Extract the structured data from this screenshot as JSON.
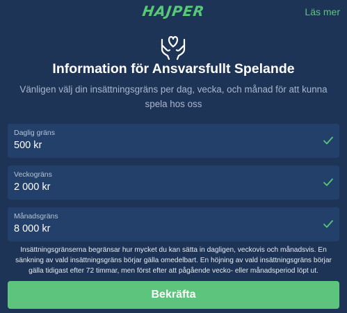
{
  "header": {
    "logo_text": "HAJPER",
    "read_more": "Läs mer"
  },
  "icons": {
    "hero": "hands-heart-icon",
    "check": "check-icon"
  },
  "title": "Information för Ansvarsfullt Spelande",
  "subtitle": "Vänligen välj din insättningsgräns per dag, vecka, och månad för att kunna spela hos oss",
  "limits": [
    {
      "label": "Daglig gräns",
      "value": "500 kr"
    },
    {
      "label": "Veckogräns",
      "value": "2 000 kr"
    },
    {
      "label": "Månadsgräns",
      "value": "8 000 kr"
    }
  ],
  "notice": "Insättningsgränserna begränsar hur mycket du kan sätta in dagligen, veckovis och månadsvis. En sänkning av vald insättningsgräns börjar gälla omedelbart. En höjning av vald insättningsgräns börjar gälla tidigast efter 72 timmar, men först efter att pågående vecko- eller månadsperiod löpt ut.",
  "confirm_label": "Bekräfta",
  "colors": {
    "background": "#1e3456",
    "field": "#23406a",
    "accent": "#57c878",
    "button": "#5dc47d"
  }
}
